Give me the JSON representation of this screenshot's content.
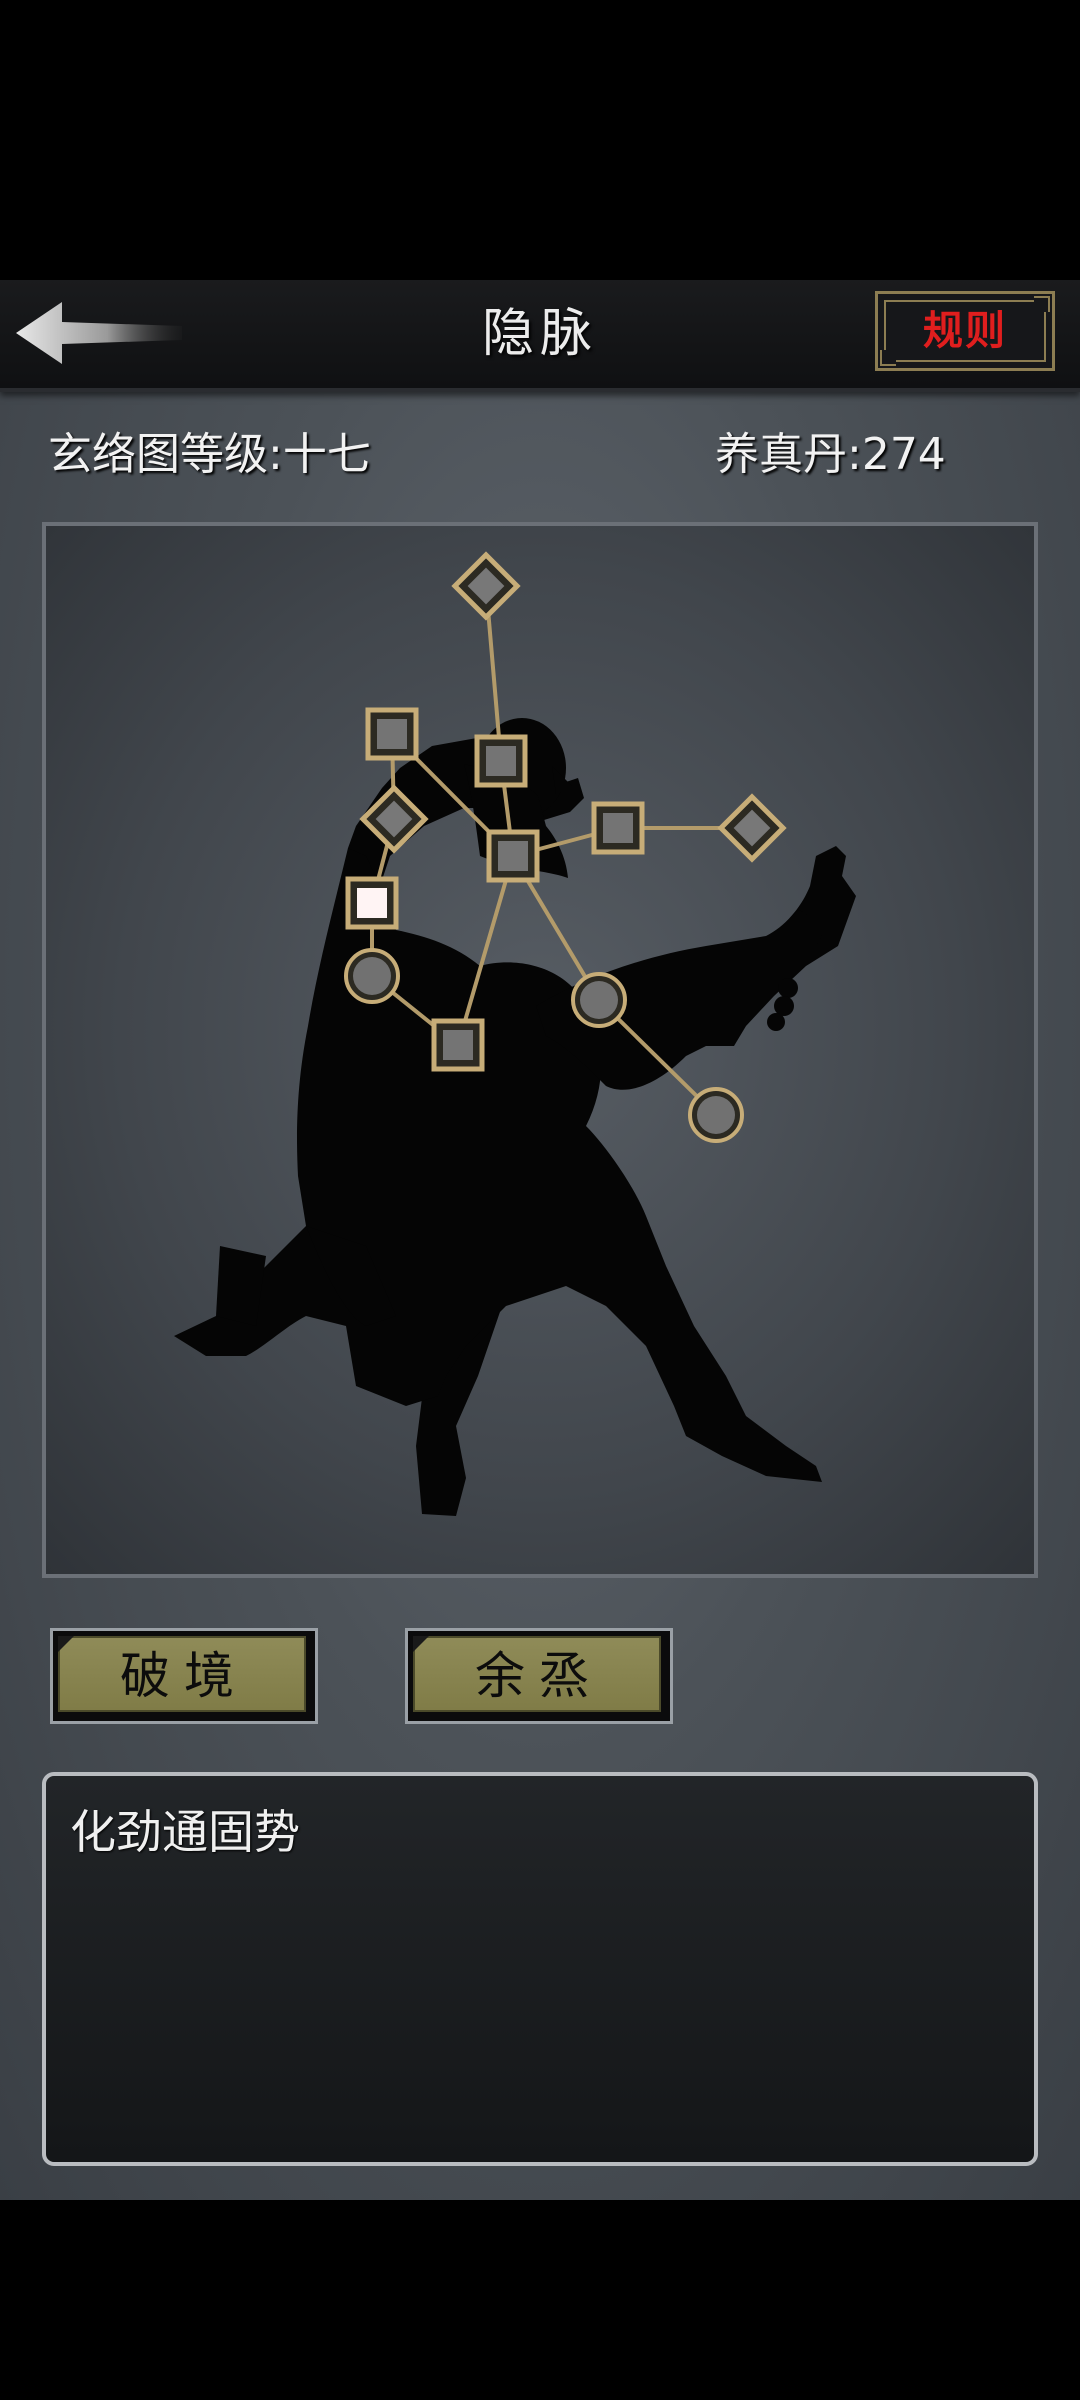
{
  "header": {
    "title": "隐脉",
    "back_icon": "back-arrow-icon",
    "rules_label": "规则"
  },
  "stats": {
    "level_text": "玄络图等级:十七",
    "pill_text": "养真丹:274"
  },
  "meridian_map": {
    "figure": "martial-artist-silhouette",
    "node_shapes": [
      "diamond",
      "square",
      "circle"
    ],
    "colors": {
      "line": "#b39b6a",
      "node_border": "#c7ad78",
      "node_fill": "#6e6e6e",
      "active_node": "#ffffff"
    }
  },
  "actions": {
    "breakthrough_label": "破境",
    "aftertaste_label": "余烝"
  },
  "description": {
    "text": "化劲通固势"
  }
}
